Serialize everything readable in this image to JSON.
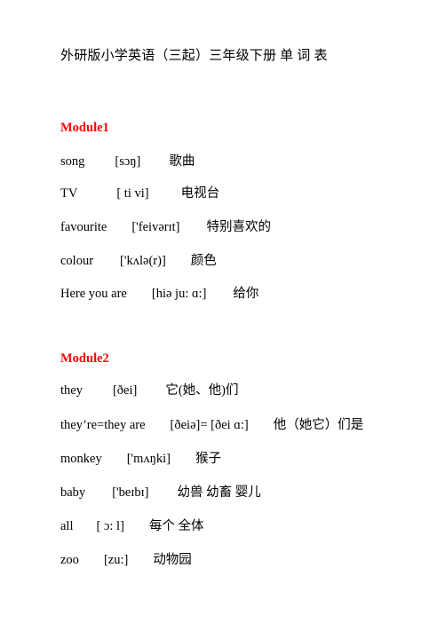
{
  "document": {
    "title": "外研版小学英语（三起）三年级下册 单 词 表",
    "accent_color": "#ff0000",
    "text_color": "#000000",
    "background_color": "#ffffff"
  },
  "modules": [
    {
      "heading": "Module1",
      "entries": [
        {
          "word": "song",
          "phonetic": "[sɔŋ]",
          "meaning": "歌曲"
        },
        {
          "word": "TV",
          "phonetic": "[ ti vi]",
          "meaning": "电视台"
        },
        {
          "word": "favourite",
          "phonetic": "['feivərɪt]",
          "meaning": "特别喜欢的"
        },
        {
          "word": "colour",
          "phonetic": "['kʌlə(r)]",
          "meaning": "颜色"
        },
        {
          "word": "Here you are",
          "phonetic": "[hiə ju: ɑ:]",
          "meaning": "给你"
        }
      ]
    },
    {
      "heading": "Module2",
      "entries": [
        {
          "word": "they",
          "phonetic": "[ðei]",
          "meaning": "它(她、他)们"
        },
        {
          "word": "they’re=they are",
          "phonetic": "[ðeiə]= [ðei ɑ:]",
          "meaning": "他（她它）们是"
        },
        {
          "word": "monkey",
          "phonetic": "['mʌŋki]",
          "meaning": "猴子"
        },
        {
          "word": "baby",
          "phonetic": "['beɪbɪ]",
          "meaning": "幼兽 幼畜 婴儿"
        },
        {
          "word": "all",
          "phonetic": "[ ɔ: l]",
          "meaning": "每个 全体"
        },
        {
          "word": "zoo",
          "phonetic": "[zu:]",
          "meaning": "动物园"
        }
      ]
    }
  ],
  "layout": {
    "entry_tops_module1": [
      172,
      208,
      246,
      284,
      321
    ],
    "entry_tops_module2": [
      430,
      469,
      507,
      545,
      583,
      621
    ],
    "word_widths_module1": [
      52,
      52,
      76,
      52,
      92
    ],
    "word_widths_module2": [
      52,
      124,
      68,
      52,
      38,
      38
    ],
    "phon_widths_module1": [
      66,
      80,
      104,
      92,
      100
    ],
    "phon_widths_module2": [
      66,
      136,
      86,
      80,
      62,
      60
    ]
  }
}
